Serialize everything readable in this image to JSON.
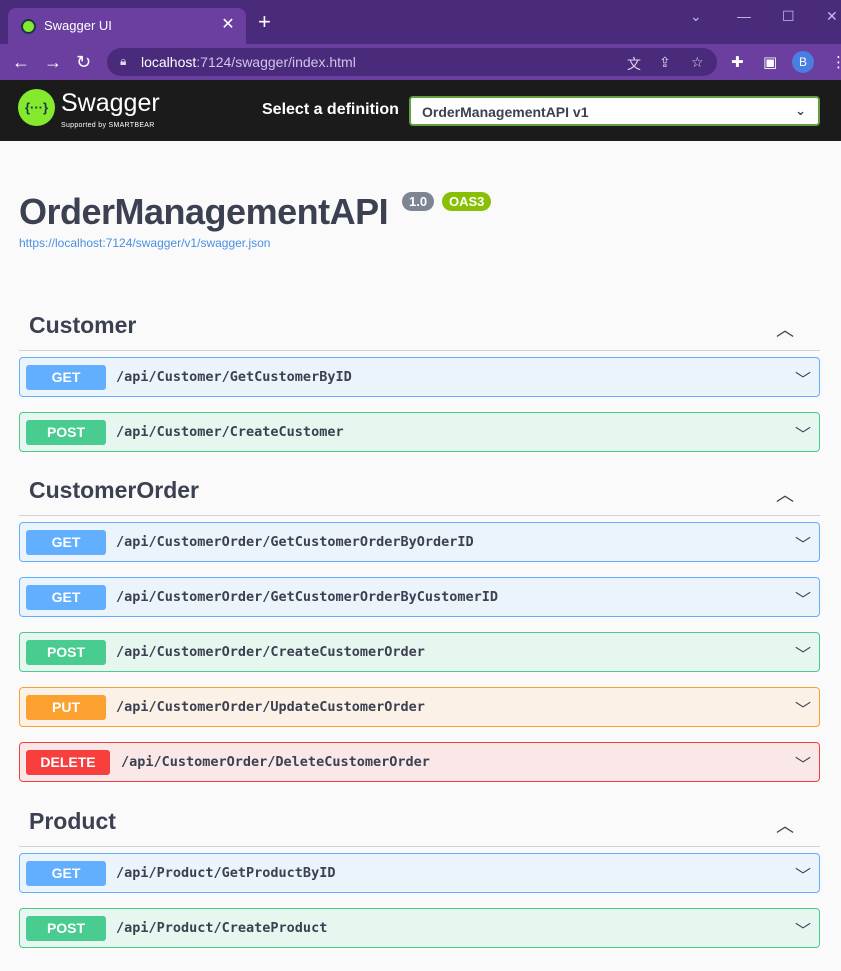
{
  "browser": {
    "tab_title": "Swagger UI",
    "tab_close": "✕",
    "new_tab": "+",
    "url_host": "localhost",
    "url_rest": ":7124/swagger/index.html",
    "avatar_initial": "B"
  },
  "topbar": {
    "logo_mark": "{···}",
    "logo_text": "Swagger",
    "logo_sub": "Supported by SMARTBEAR",
    "definition_label": "Select a definition",
    "definition_selected": "OrderManagementAPI v1"
  },
  "info": {
    "title": "OrderManagementAPI",
    "version": "1.0",
    "oas": "OAS3",
    "spec_url": "https://localhost:7124/swagger/v1/swagger.json"
  },
  "sections": [
    {
      "name": "Customer",
      "operations": [
        {
          "method": "GET",
          "path": "/api/Customer/GetCustomerByID"
        },
        {
          "method": "POST",
          "path": "/api/Customer/CreateCustomer"
        }
      ]
    },
    {
      "name": "CustomerOrder",
      "operations": [
        {
          "method": "GET",
          "path": "/api/CustomerOrder/GetCustomerOrderByOrderID"
        },
        {
          "method": "GET",
          "path": "/api/CustomerOrder/GetCustomerOrderByCustomerID"
        },
        {
          "method": "POST",
          "path": "/api/CustomerOrder/CreateCustomerOrder"
        },
        {
          "method": "PUT",
          "path": "/api/CustomerOrder/UpdateCustomerOrder"
        },
        {
          "method": "DELETE",
          "path": "/api/CustomerOrder/DeleteCustomerOrder"
        }
      ]
    },
    {
      "name": "Product",
      "operations": [
        {
          "method": "GET",
          "path": "/api/Product/GetProductByID"
        },
        {
          "method": "POST",
          "path": "/api/Product/CreateProduct"
        }
      ]
    }
  ],
  "colors": {
    "get": "#61affe",
    "post": "#49cc90",
    "put": "#fca130",
    "delete": "#f93e3e",
    "swagger_green": "#85ea2d"
  }
}
